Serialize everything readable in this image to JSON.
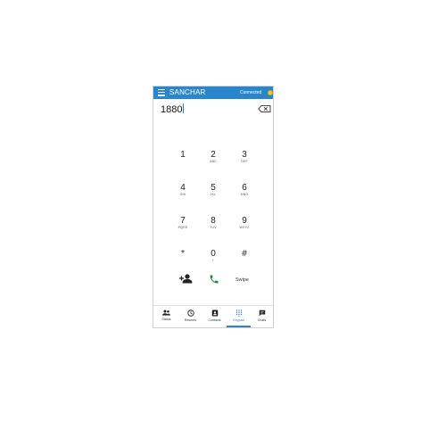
{
  "app": {
    "title": "SANCHAR",
    "status": "Connected",
    "status_color": "#f3c623",
    "accent": "#2a86cc"
  },
  "dialer": {
    "number": "1880",
    "backspace_icon": "backspace-icon",
    "keys": [
      {
        "digit": "1",
        "letters": ""
      },
      {
        "digit": "2",
        "letters": "ABC"
      },
      {
        "digit": "3",
        "letters": "DEF"
      },
      {
        "digit": "4",
        "letters": "GHI"
      },
      {
        "digit": "5",
        "letters": "JKL"
      },
      {
        "digit": "6",
        "letters": "MNO"
      },
      {
        "digit": "7",
        "letters": "PQRS"
      },
      {
        "digit": "8",
        "letters": "TUV"
      },
      {
        "digit": "9",
        "letters": "WXYZ"
      },
      {
        "digit": "*",
        "letters": ""
      },
      {
        "digit": "0",
        "letters": "+"
      },
      {
        "digit": "#",
        "letters": ""
      }
    ],
    "actions": {
      "add_contact_icon": "add-contact-icon",
      "call_icon": "phone-call-icon",
      "swipe_label": "Swipe"
    }
  },
  "bottom_nav": {
    "active": "Keypad",
    "tabs": [
      {
        "label": "Status",
        "icon": "people-icon"
      },
      {
        "label": "Recents",
        "icon": "clock-icon"
      },
      {
        "label": "Contacts",
        "icon": "contacts-book-icon"
      },
      {
        "label": "Keypad",
        "icon": "dialpad-icon"
      },
      {
        "label": "Chats",
        "icon": "chat-icon"
      }
    ]
  }
}
